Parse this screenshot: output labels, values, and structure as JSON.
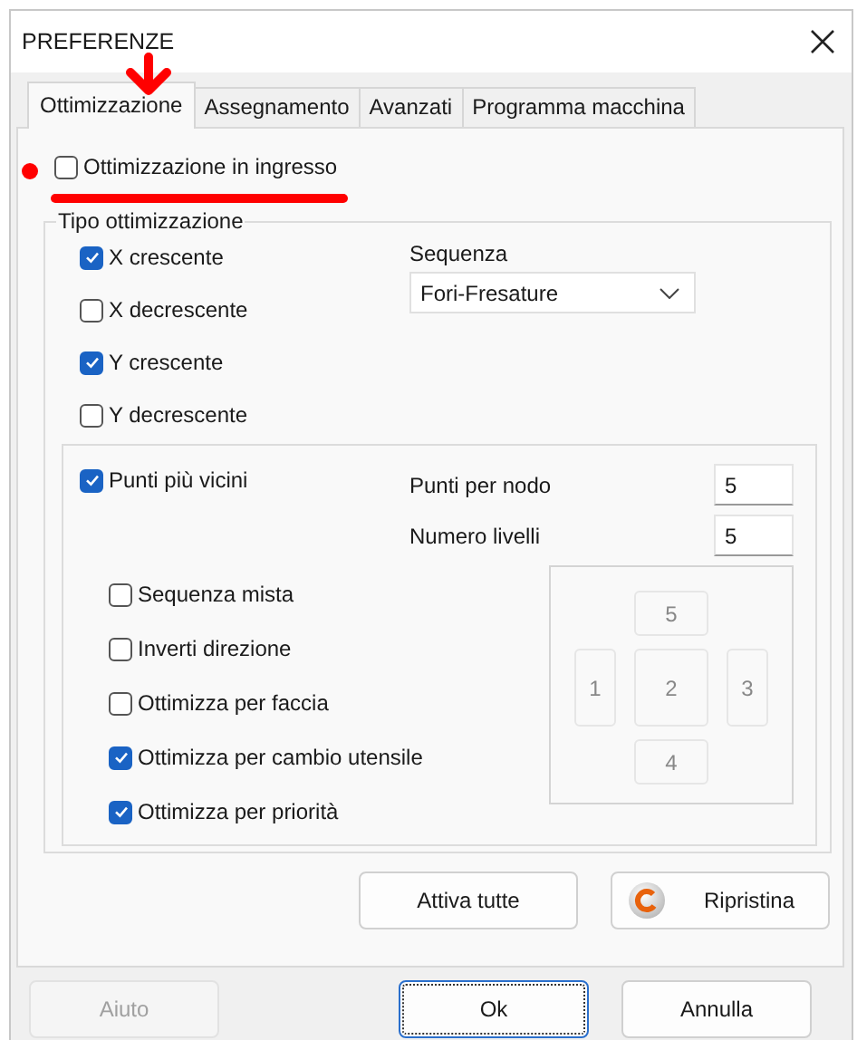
{
  "window": {
    "title": "PREFERENZE"
  },
  "tabs": [
    {
      "label": "Ottimizzazione",
      "selected": true
    },
    {
      "label": "Assegnamento",
      "selected": false
    },
    {
      "label": "Avanzati",
      "selected": false
    },
    {
      "label": "Programma macchina",
      "selected": false
    }
  ],
  "incoming": {
    "label": "Ottimizzazione in ingresso",
    "checked": false
  },
  "group": {
    "title": "Tipo ottimizzazione",
    "options": [
      {
        "label": "X crescente",
        "checked": true
      },
      {
        "label": "X decrescente",
        "checked": false
      },
      {
        "label": "Y crescente",
        "checked": true
      },
      {
        "label": "Y decrescente",
        "checked": false
      }
    ],
    "sequence": {
      "label": "Sequenza",
      "value": "Fori-Fresature"
    }
  },
  "nearest": {
    "label": "Punti più vicini",
    "checked": true,
    "fields": [
      {
        "label": "Punti per nodo",
        "value": "5"
      },
      {
        "label": "Numero livelli",
        "value": "5"
      }
    ],
    "options": [
      {
        "label": "Sequenza mista",
        "checked": false
      },
      {
        "label": "Inverti direzione",
        "checked": false
      },
      {
        "label": "Ottimizza per faccia",
        "checked": false
      },
      {
        "label": "Ottimizza per cambio utensile",
        "checked": true
      },
      {
        "label": "Ottimizza per priorità",
        "checked": true
      }
    ],
    "faces": [
      "5",
      "1",
      "2",
      "3",
      "4"
    ]
  },
  "actions": [
    {
      "label": "Attiva tutte",
      "kind": "plain"
    },
    {
      "label": "Ripristina",
      "kind": "reset"
    }
  ],
  "buttons": [
    {
      "label": "Aiuto",
      "disabled": true,
      "focused": false
    },
    {
      "label": "Ok",
      "disabled": false,
      "focused": true
    },
    {
      "label": "Annulla",
      "disabled": false,
      "focused": false
    }
  ]
}
